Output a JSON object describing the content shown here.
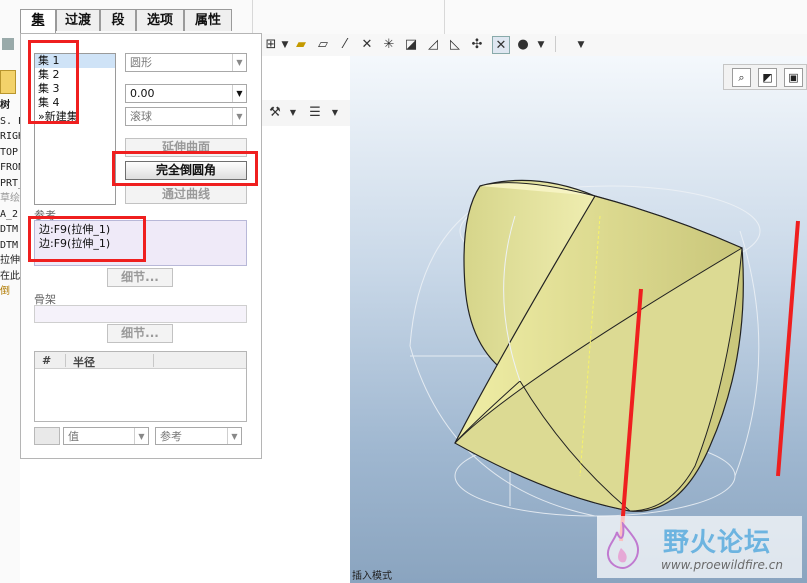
{
  "tabs": [
    "集",
    "过渡",
    "段",
    "选项",
    "属性"
  ],
  "set_list": {
    "items": [
      "集 1",
      "集 2",
      "集 3",
      "集 4"
    ],
    "new_set": "»新建集",
    "selected_index": 0
  },
  "dropdowns": {
    "shape": "圆形",
    "value": "0.00",
    "ball": "滚球"
  },
  "buttons": {
    "extend_surface": "延伸曲面",
    "full_round": "完全倒圆角",
    "through_curve": "通过曲线",
    "details_ref": "细节...",
    "details_skeleton": "细节..."
  },
  "references": {
    "label": "参考",
    "edges": [
      "边:F9(拉伸_1)",
      "边:F9(拉伸_1)"
    ]
  },
  "skeleton_label": "骨架",
  "radius_table": {
    "col_num": "#",
    "col_radius": "半径"
  },
  "bottom_dropdowns": {
    "value": "值",
    "reference": "参考"
  },
  "left_tree": [
    "树",
    "S. PR",
    "RIGH",
    "TOP",
    "FRON",
    "PRT_",
    "草绘",
    "A_2",
    "DTM",
    "DTM",
    "拉伸",
    "在此",
    "倒"
  ],
  "status_bar": "插入模式",
  "watermark": {
    "title": "野火论坛",
    "url": "www.proewildfire.cn"
  },
  "colors": {
    "highlight": "#ef1f1f",
    "model_fill": "#ecea9e",
    "selection": "#cfe3f7"
  }
}
